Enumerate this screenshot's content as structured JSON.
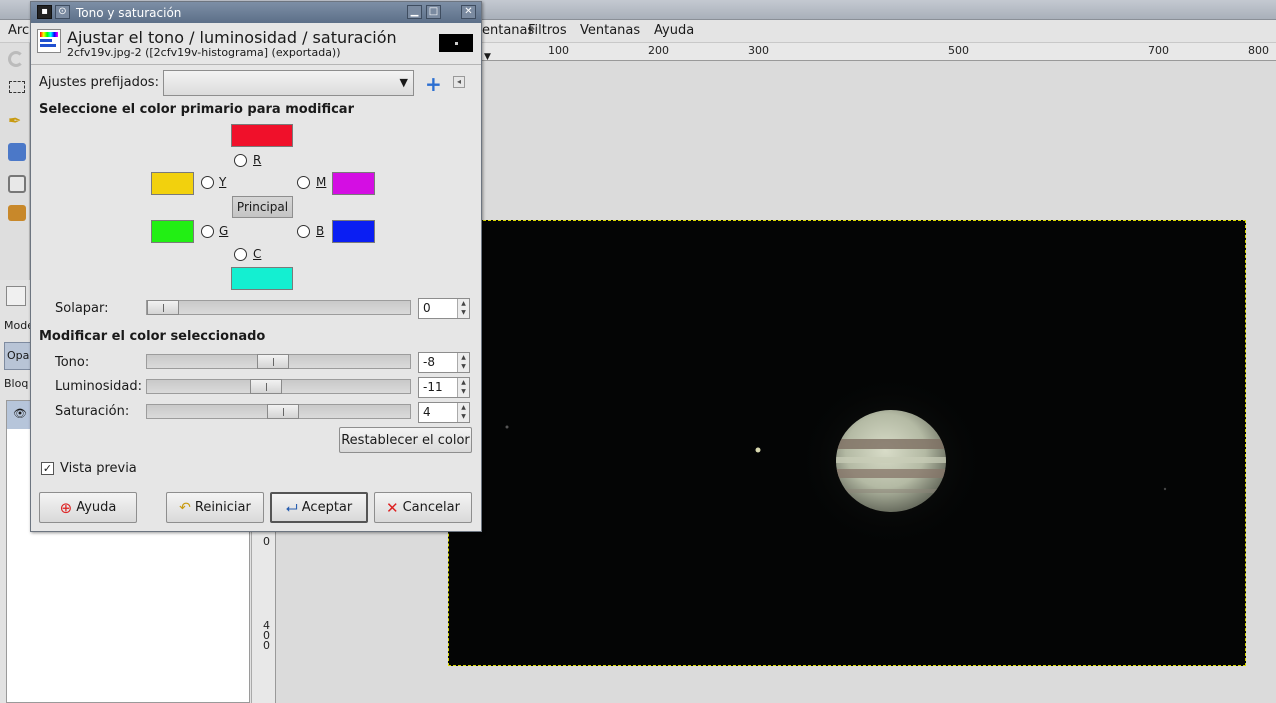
{
  "main_window": {
    "menubar": {
      "items": [
        "Arc",
        "entanas",
        "Filtros",
        "Ventanas",
        "Ayuda"
      ]
    },
    "left_panel": {
      "mode_label": "Mode",
      "opacity_label": "Opa",
      "lock_label": "Bloq"
    },
    "ruler_top_ticks": [
      "100",
      "200",
      "300",
      "500",
      "700",
      "800"
    ],
    "ruler_left_ticks": [
      "0",
      "4",
      "0",
      "0"
    ]
  },
  "dialog": {
    "window_title": "Tono y saturación",
    "heading_title": "Ajustar el tono / luminosidad / saturación",
    "subtitle": "2cfv19v.jpg-2 ([2cfv19v-histograma] (exportada))",
    "presets_label": "Ajustes prefijados:",
    "presets_value": "",
    "section_primary": "Seleccione el color primario para modificar",
    "colors": {
      "R": {
        "label": "R",
        "hex": "#f0102a"
      },
      "Y": {
        "label": "Y",
        "hex": "#f2d10d"
      },
      "M": {
        "label": "M",
        "hex": "#d40ee3"
      },
      "G": {
        "label": "G",
        "hex": "#22ef14"
      },
      "B": {
        "label": "B",
        "hex": "#0a1ef3"
      },
      "C": {
        "label": "C",
        "hex": "#14efd1"
      }
    },
    "principal_label": "Principal",
    "overlap": {
      "label": "Solapar:",
      "value": "0",
      "level": 0
    },
    "section_modify": "Modificar el color seleccionado",
    "hue": {
      "label": "Tono:",
      "value": "-8",
      "level": -8,
      "min": -180,
      "max": 180
    },
    "lightness": {
      "label": "Luminosidad:",
      "value": "-11",
      "level": -11,
      "min": -100,
      "max": 100
    },
    "saturation": {
      "label": "Saturación:",
      "value": "4",
      "level": 4,
      "min": -100,
      "max": 100
    },
    "reset_color_label": "Restablecer el color",
    "preview_label": "Vista previa",
    "preview_checked": true,
    "buttons": {
      "help": "Ayuda",
      "reset": "Reiniciar",
      "ok": "Aceptar",
      "cancel": "Cancelar"
    }
  }
}
